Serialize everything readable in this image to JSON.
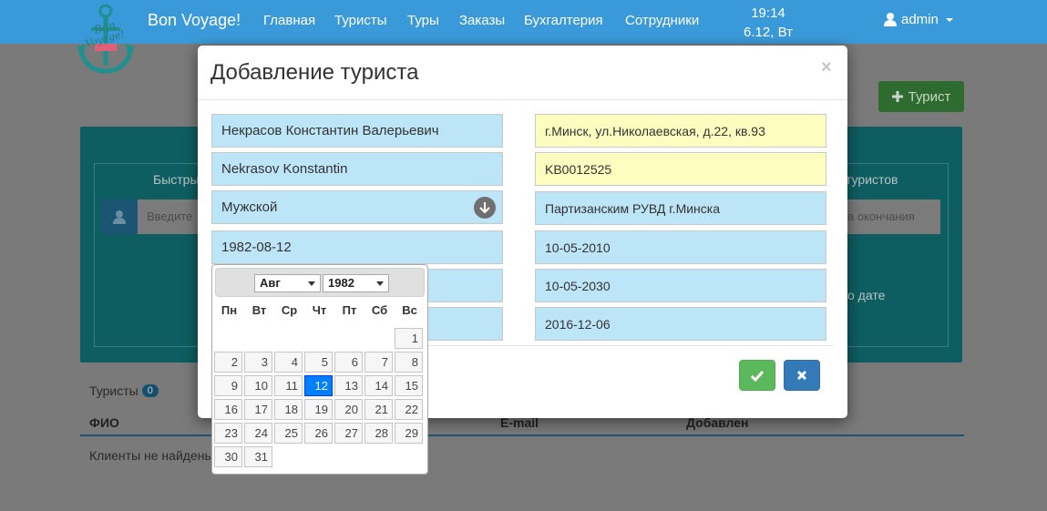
{
  "nav": {
    "brand": "Bon Voyage!",
    "logo_text": "Bon Voyage!",
    "items": [
      "Главная",
      "Туристы",
      "Туры",
      "Заказы",
      "Бухгалтерия",
      "Сотрудники"
    ],
    "time": "19:14",
    "date": "6.12, Вт",
    "user": "admin"
  },
  "background": {
    "add_button": "Турист",
    "quick_label": "Быстры",
    "tourists_filter_label": "туристов",
    "search_placeholder": "Введите",
    "end_date_placeholder": "а окончания",
    "by_date_label": "о дате",
    "tourists_label": "Туристы",
    "tourists_count": "0",
    "columns": [
      "ФИО",
      "E-mail",
      "Добавлен"
    ],
    "empty_text": "Клиенты не найдены"
  },
  "modal": {
    "title": "Добавление туриста",
    "close": "×",
    "left_fields": {
      "full_name": "Некрасов Константин Валерьевич",
      "latin_name": "Nekrasov Konstantin",
      "gender": "Мужской",
      "birth_date": "1982-08-12"
    },
    "right_fields": {
      "address": "г.Минск, ул.Николаевская, д.22, кв.93",
      "passport_number": "KB0012525",
      "issued_by": "Партизанским РУВД г.Минска",
      "issue_date": "10-05-2010",
      "expiry_date": "10-05-2030",
      "registration_date": "2016-12-06"
    }
  },
  "datepicker": {
    "month": "Авг",
    "year": "1982",
    "weekdays": [
      "Пн",
      "Вт",
      "Ср",
      "Чт",
      "Пт",
      "Сб",
      "Вс"
    ],
    "selected_day": 12,
    "weeks": [
      [
        "",
        "",
        "",
        "",
        "",
        "",
        "1"
      ],
      [
        "2",
        "3",
        "4",
        "5",
        "6",
        "7",
        "8"
      ],
      [
        "9",
        "10",
        "11",
        "12",
        "13",
        "14",
        "15"
      ],
      [
        "16",
        "17",
        "18",
        "19",
        "20",
        "21",
        "22"
      ],
      [
        "23",
        "24",
        "25",
        "26",
        "27",
        "28",
        "29"
      ],
      [
        "30",
        "31",
        "",
        "",
        "",
        "",
        ""
      ]
    ]
  },
  "colors": {
    "navbar": "#3a9ad9",
    "field_blue": "#bde5f8",
    "field_yellow": "#fdfdc0",
    "ok_button": "#5cb85c",
    "cancel_button": "#337ab7",
    "selected_day": "#007fff"
  }
}
